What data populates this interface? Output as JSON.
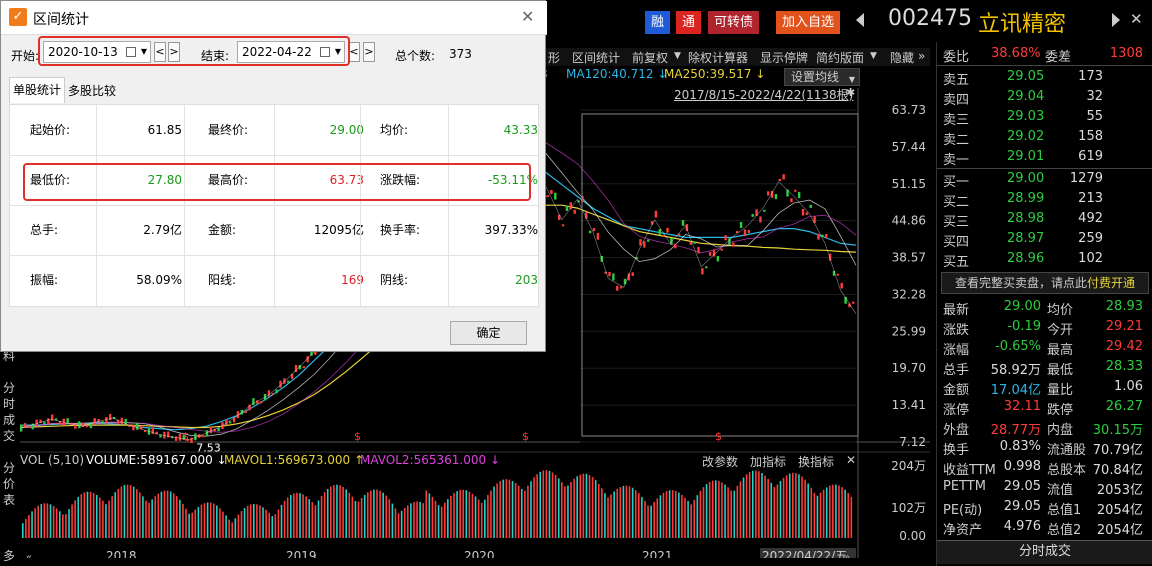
{
  "topbar": {
    "btn_finance": "融",
    "btn_tong": "通",
    "btn_convertible": "可转债",
    "btn_add_watch": "加入自选",
    "code": "002475",
    "name": "立讯精密"
  },
  "toolbar": {
    "items": [
      "形",
      "区间统计",
      "前复权",
      "除权计算器",
      "显示停牌",
      "简约版面",
      "隐藏"
    ]
  },
  "chart_header": {
    "ma120": "MA120:40.712 ↓",
    "ma250": "MA250:39.517 ↓",
    "ma_prefix": "3",
    "set_ma": "设置均线",
    "range": "2017/8/15-2022/4/22(1138根)",
    "high_label": "63.73",
    "low_label": "7.53"
  },
  "chart_data": {
    "type": "line",
    "title": "",
    "y_ticks": [
      "63.73",
      "57.44",
      "51.15",
      "44.86",
      "38.57",
      "32.28",
      "25.99",
      "19.70",
      "13.41",
      "7.12"
    ],
    "x_ticks": [
      "2018",
      "2019",
      "2020",
      "2021",
      "2022/04/22/五"
    ],
    "vol_ticks": [
      "204万",
      "102万",
      "0.00"
    ],
    "vol_header": {
      "vol": "VOL (5,10)",
      "volume": "VOLUME:589167.000 ↓",
      "mavol1": "MAVOL1:569673.000 ↑",
      "mavol2": "MAVOL2:565361.000 ↓",
      "btn_params": "改参数",
      "btn_add": "加指标",
      "btn_switch": "换指标",
      "close": "✕"
    },
    "price_series": {
      "name": "",
      "values": [
        9.5,
        10.2,
        11.0,
        10.4,
        9.8,
        10.6,
        11.2,
        10.0,
        9.2,
        8.4,
        7.9,
        7.53,
        8.6,
        9.8,
        11.5,
        13.6,
        15.0,
        17.2,
        19.8,
        22.5,
        26.0,
        29.5,
        33.0,
        35.5,
        38.0,
        42.0,
        47.0,
        52.0,
        57.0,
        61.0,
        63.73,
        58.0,
        61.5,
        55.0,
        50.5,
        45.0,
        48.5,
        43.0,
        35.0,
        33.5,
        40.0,
        45.0,
        41.0,
        44.0,
        37.0,
        39.5,
        42.0,
        44.0,
        47.0,
        51.5,
        49.0,
        46.0,
        41.0,
        33.0,
        29.0
      ]
    },
    "ma_series": [
      {
        "name": "MA120",
        "color": "#2ab7e6",
        "values": [
          10.0,
          10.0,
          10.1,
          10.2,
          10.2,
          10.3,
          10.2,
          10.0,
          9.6,
          9.4,
          9.2,
          9.4,
          9.8,
          10.6,
          11.6,
          13.0,
          14.6,
          16.4,
          18.5,
          21.0,
          23.5,
          26.5,
          29.5,
          32.5,
          35.5,
          39.0,
          42.5,
          46.0,
          49.0,
          52.0,
          54.0,
          55.0,
          55.5,
          55.0,
          53.0,
          51.0,
          49.0,
          47.0,
          45.5,
          44.0,
          43.5,
          43.0,
          42.5,
          42.0,
          42.0,
          42.0,
          42.0,
          42.5,
          43.0,
          43.5,
          43.5,
          43.0,
          42.0,
          41.0,
          40.7
        ]
      },
      {
        "name": "MA250",
        "color": "#e6d23a",
        "values": [
          9.6,
          9.7,
          9.8,
          9.9,
          10.0,
          10.0,
          10.0,
          10.0,
          9.9,
          9.8,
          9.7,
          9.6,
          9.6,
          9.8,
          10.2,
          10.8,
          11.6,
          12.6,
          13.8,
          15.2,
          17.0,
          19.0,
          21.2,
          23.5,
          26.0,
          28.5,
          31.0,
          34.0,
          37.0,
          40.0,
          42.5,
          44.5,
          46.0,
          47.0,
          47.5,
          47.5,
          47.0,
          46.0,
          45.0,
          44.0,
          43.0,
          42.5,
          42.0,
          41.5,
          41.0,
          40.8,
          40.6,
          40.5,
          40.3,
          40.2,
          40.0,
          39.9,
          39.8,
          39.6,
          39.5
        ]
      }
    ],
    "ylim": [
      7.12,
      63.73
    ]
  },
  "left_strip": {
    "top_char": "料",
    "tab1": "分时成交",
    "tab2": "分价表",
    "tab3": "多"
  },
  "quotes": {
    "weibi_label": "委比",
    "weibi_val": "38.68%",
    "weicha_label": "委差",
    "weicha_val": "1308",
    "asks": [
      {
        "label": "卖五",
        "price": "29.05",
        "vol": "173"
      },
      {
        "label": "卖四",
        "price": "29.04",
        "vol": "32"
      },
      {
        "label": "卖三",
        "price": "29.03",
        "vol": "55"
      },
      {
        "label": "卖二",
        "price": "29.02",
        "vol": "158"
      },
      {
        "label": "卖一",
        "price": "29.01",
        "vol": "619"
      }
    ],
    "bids": [
      {
        "label": "买一",
        "price": "29.00",
        "vol": "1279"
      },
      {
        "label": "买二",
        "price": "28.99",
        "vol": "213"
      },
      {
        "label": "买三",
        "price": "28.98",
        "vol": "492"
      },
      {
        "label": "买四",
        "price": "28.97",
        "vol": "259"
      },
      {
        "label": "买五",
        "price": "28.96",
        "vol": "102"
      }
    ],
    "promo_text": "查看完整买卖盘，请点此",
    "promo_link": "付费开通",
    "stats": [
      {
        "l1": "最新",
        "v1": "29.00",
        "c1": "#2ecc40",
        "l2": "均价",
        "v2": "28.93",
        "c2": "#2ecc40"
      },
      {
        "l1": "涨跌",
        "v1": "-0.19",
        "c1": "#2ecc40",
        "l2": "今开",
        "v2": "29.21",
        "c2": "#ff3b3b"
      },
      {
        "l1": "涨幅",
        "v1": "-0.65%",
        "c1": "#2ecc40",
        "l2": "最高",
        "v2": "29.42",
        "c2": "#ff3b3b"
      },
      {
        "l1": "总手",
        "v1": "58.92万",
        "c1": "#dddddd",
        "l2": "最低",
        "v2": "28.33",
        "c2": "#2ecc40"
      },
      {
        "l1": "金额",
        "v1": "17.04亿",
        "c1": "#2ab7e6",
        "l2": "量比",
        "v2": "1.06",
        "c2": "#dddddd"
      },
      {
        "l1": "涨停",
        "v1": "32.11",
        "c1": "#ff3b3b",
        "l2": "跌停",
        "v2": "26.27",
        "c2": "#2ecc40"
      },
      {
        "l1": "外盘",
        "v1": "28.77万",
        "c1": "#ff3b3b",
        "l2": "内盘",
        "v2": "30.15万",
        "c2": "#2ecc40"
      },
      {
        "l1": "换手",
        "v1": "0.83%",
        "c1": "#dddddd",
        "l2": "流通股",
        "v2": "70.79亿",
        "c2": "#dddddd"
      },
      {
        "l1": "收益TTM",
        "v1": "0.998",
        "c1": "#dddddd",
        "l2": "总股本",
        "v2": "70.84亿",
        "c2": "#dddddd"
      },
      {
        "l1": "PETTM",
        "v1": "29.05",
        "c1": "#dddddd",
        "l2": "流值",
        "v2": "2053亿",
        "c2": "#dddddd"
      },
      {
        "l1": "PE(动)",
        "v1": "29.05",
        "c1": "#dddddd",
        "l2": "总值1",
        "v2": "2054亿",
        "c2": "#dddddd"
      },
      {
        "l1": "净资产",
        "v1": "4.976",
        "c1": "#dddddd",
        "l2": "总值2",
        "v2": "2054亿",
        "c2": "#dddddd"
      }
    ],
    "bottom_tab": "分时成交"
  },
  "dialog": {
    "title": "区间统计",
    "start_label": "开始:",
    "start_date": "2020-10-13",
    "end_label": "结束:",
    "end_date": "2022-04-22",
    "count_label": "总个数:",
    "count_val": "373",
    "tab_single": "单股统计",
    "tab_multi": "多股比较",
    "rows": [
      [
        {
          "label": "起始价:",
          "val": "61.85",
          "color": "#000000"
        },
        {
          "label": "最终价:",
          "val": "29.00",
          "color": "#1a9a1a"
        },
        {
          "label": "均价:",
          "val": "43.33",
          "color": "#1a9a1a"
        }
      ],
      [
        {
          "label": "最低价:",
          "val": "27.80",
          "color": "#1a9a1a"
        },
        {
          "label": "最高价:",
          "val": "63.73",
          "color": "#e02020"
        },
        {
          "label": "涨跌幅:",
          "val": "-53.11%",
          "color": "#1a9a1a"
        }
      ],
      [
        {
          "label": "总手:",
          "val": "2.79亿",
          "color": "#000000"
        },
        {
          "label": "金额:",
          "val": "12095亿",
          "color": "#000000"
        },
        {
          "label": "换手率:",
          "val": "397.33%",
          "color": "#000000"
        }
      ],
      [
        {
          "label": "振幅:",
          "val": "58.09%",
          "color": "#000000"
        },
        {
          "label": "阳线:",
          "val": "169",
          "color": "#e02020"
        },
        {
          "label": "阴线:",
          "val": "203",
          "color": "#1a9a1a"
        }
      ]
    ],
    "ok": "确定",
    "check_mark": "✓"
  }
}
